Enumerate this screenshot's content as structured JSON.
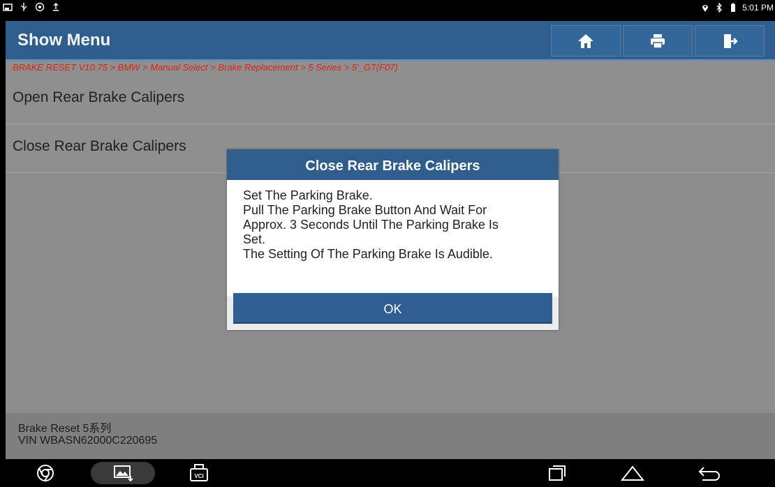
{
  "status_bar": {
    "left_icons": [
      "screenshot-icon",
      "usb-icon",
      "settings-gear-icon",
      "upload-icon"
    ],
    "right_icons": [
      "location-icon",
      "bluetooth-icon",
      "battery-icon"
    ],
    "time": "5:01 PM"
  },
  "header": {
    "title": "Show Menu",
    "buttons": [
      "home-icon",
      "print-icon",
      "exit-icon"
    ]
  },
  "breadcrumb": "BRAKE RESET V10.75 > BMW > Manual Select > Brake Replacement > 5 Series > 5'_GT(F07)",
  "menu": {
    "items": [
      {
        "label": "Open Rear Brake Calipers"
      },
      {
        "label": "Close Rear Brake Calipers"
      }
    ]
  },
  "footer": {
    "line1": "Brake Reset 5系列",
    "line2": "VIN WBASN62000C220695"
  },
  "dialog": {
    "title": "Close Rear Brake Calipers",
    "lines": [
      "Set The Parking Brake.",
      "Pull The Parking Brake Button And Wait For",
      "Approx. 3 Seconds Until The Parking Brake Is",
      "Set.",
      "The Setting Of The Parking Brake Is Audible."
    ],
    "ok_label": "OK"
  },
  "navbar": {
    "vci_label": "VCI",
    "icons": [
      "browser-icon",
      "gallery-icon",
      "vci-icon",
      "recent-apps-icon",
      "home-nav-icon",
      "back-icon"
    ]
  },
  "colors": {
    "header": "#2f5d8c",
    "breadcrumb_text": "#d8261a",
    "button": "#2f5f92"
  }
}
